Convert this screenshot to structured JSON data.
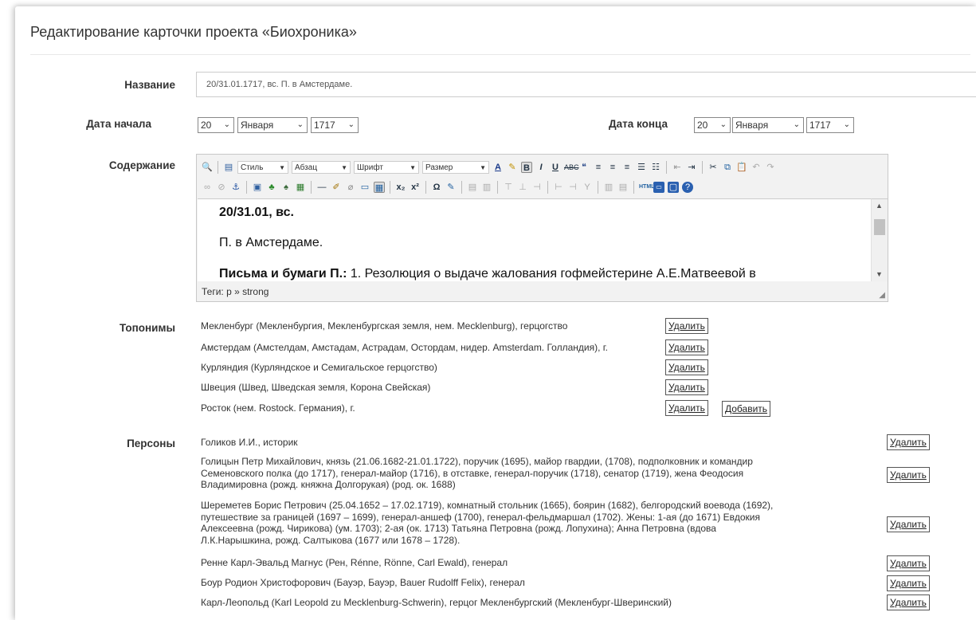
{
  "page": {
    "title": "Редактирование карточки проекта «Биохроника»"
  },
  "fields": {
    "name_label": "Название",
    "name_value": "20/31.01.1717, вс. П. в Амстердаме.",
    "start_label": "Дата начала",
    "end_label": "Дата конца",
    "start_day": "20",
    "start_month": "Января",
    "start_year": "1717",
    "end_day": "20",
    "end_month": "Января",
    "end_year": "1717",
    "content_label": "Содержание"
  },
  "editor": {
    "style_label": "Стиль",
    "para_label": "Абзац",
    "font_label": "Шрифт",
    "size_label": "Размер",
    "line1": "20/31.01, вс.",
    "line2": "П. в Амстердаме.",
    "line3_bold": "Письма и бумаги П.:",
    "line3_rest": " 1. Резолюция о выдаче жалования гофмейстерине А.Е.Матвеевой в",
    "tags": "Теги: p » strong"
  },
  "toponyms": {
    "label": "Топонимы",
    "delete_label": "Удалить",
    "add_label": "Добавить",
    "items": [
      "Мекленбург (Мекленбургия, Мекленбургская земля, нем. Mecklenburg), герцогство",
      "Амстердам (Амстелдам, Амстадам, Астрадам, Остордам, нидер. Amsterdam. Голландия), г.",
      "Курляндия (Курляндское и Семигальское герцогство)",
      "Швеция (Швед, Шведская земля, Корона Свейская)",
      "Росток (нем. Rostock. Германия), г."
    ]
  },
  "persons": {
    "label": "Персоны",
    "delete_label": "Удалить",
    "items": [
      [
        "Голиков И.И., историк"
      ],
      [
        "Голицын Петр Михайлович, князь (21.06.1682-21.01.1722), поручик (1695), майор гвардии, (1708), подполковник и командир",
        "Семеновского полка (до 1717), генерал-майор (1716), в отставке, генерал-поручик (1718), сенатор (1719), жена Феодосия",
        "Владимировна (рожд. княжна Долгорукая) (род. ок. 1688)"
      ],
      [
        "Шереметев Борис Петрович (25.04.1652 – 17.02.1719), комнатный стольник (1665), боярин (1682), белгородский воевода (1692),",
        "путешествие за границей (1697 – 1699), генерал-аншеф (1700), генерал-фельдмаршал (1702). Жены: 1-ая (до 1671) Евдокия",
        "Алексеевна (рожд. Чирикова) (ум. 1703); 2-ая (ок. 1713) Татьяна Петровна (рожд. Лопухина); Анна Петровна (вдова",
        "Л.К.Нарышкина, рожд. Салтыкова (1677 или 1678 – 1728)."
      ],
      [
        "Ренне Карл-Эвальд Магнус (Рен, Rénne, Rönne, Carl Ewald), генерал"
      ],
      [
        "Боур Родион Христофорович (Бауэр, Бауэр, Bauer Rudolff Felix), генерал"
      ],
      [
        "Карл-Леопольд (Karl Leopold zu Mecklenburg-Schwerin), герцог Мекленбургский (Мекленбург-Шверинский)"
      ]
    ]
  }
}
